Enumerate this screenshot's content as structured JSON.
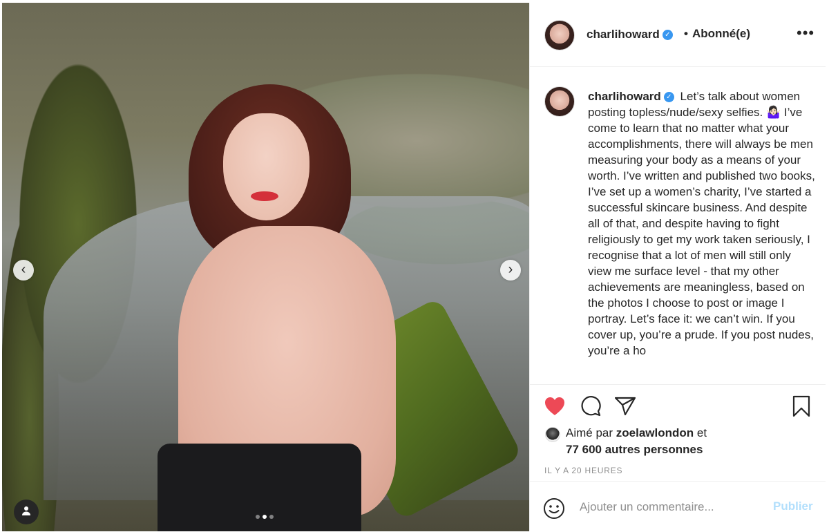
{
  "post": {
    "author": {
      "username": "charlihoward",
      "verified": true,
      "follow_status": "Abonné(e)"
    },
    "more_label": "•••",
    "caption": {
      "username": "charlihoward",
      "text": "Let’s talk about women posting topless/nude/sexy selfies. 🤷🏻‍♀️ I’ve come to learn that no matter what your accomplishments, there will always be men measuring your body as a means of your worth. I’ve written and published two books, I’ve set up a women’s charity, I’ve started a successful skincare business. And despite all of that, and despite having to fight religiously to get my work taken seriously, I recognise that a lot of men will still only view me surface level - that my other achievements are meaningless, based on the photos I choose to post or image I portray. Let’s face it: we can’t win. If you cover up, you’re a prude. If you post nudes, you’re a ho"
    },
    "media": {
      "carousel_prev": "‹",
      "carousel_next": "›",
      "slide_count": 3,
      "active_slide": 2
    },
    "likes": {
      "prefix": "Aimé par",
      "user": "zoelawlondon",
      "connector": "et",
      "others": "77 600 autres personnes"
    },
    "timestamp": "IL Y A 20 HEURES",
    "comment": {
      "placeholder": "Ajouter un commentaire...",
      "publish_label": "Publier"
    },
    "colors": {
      "like_red": "#ed4956",
      "verified_blue": "#3897f0",
      "publish_disabled": "#b2dffc",
      "meta_gray": "#8e8e8e"
    },
    "icons": [
      "heart-icon",
      "comment-icon",
      "share-icon",
      "bookmark-icon",
      "emoji-icon",
      "user-tag-icon",
      "verified-icon"
    ]
  }
}
